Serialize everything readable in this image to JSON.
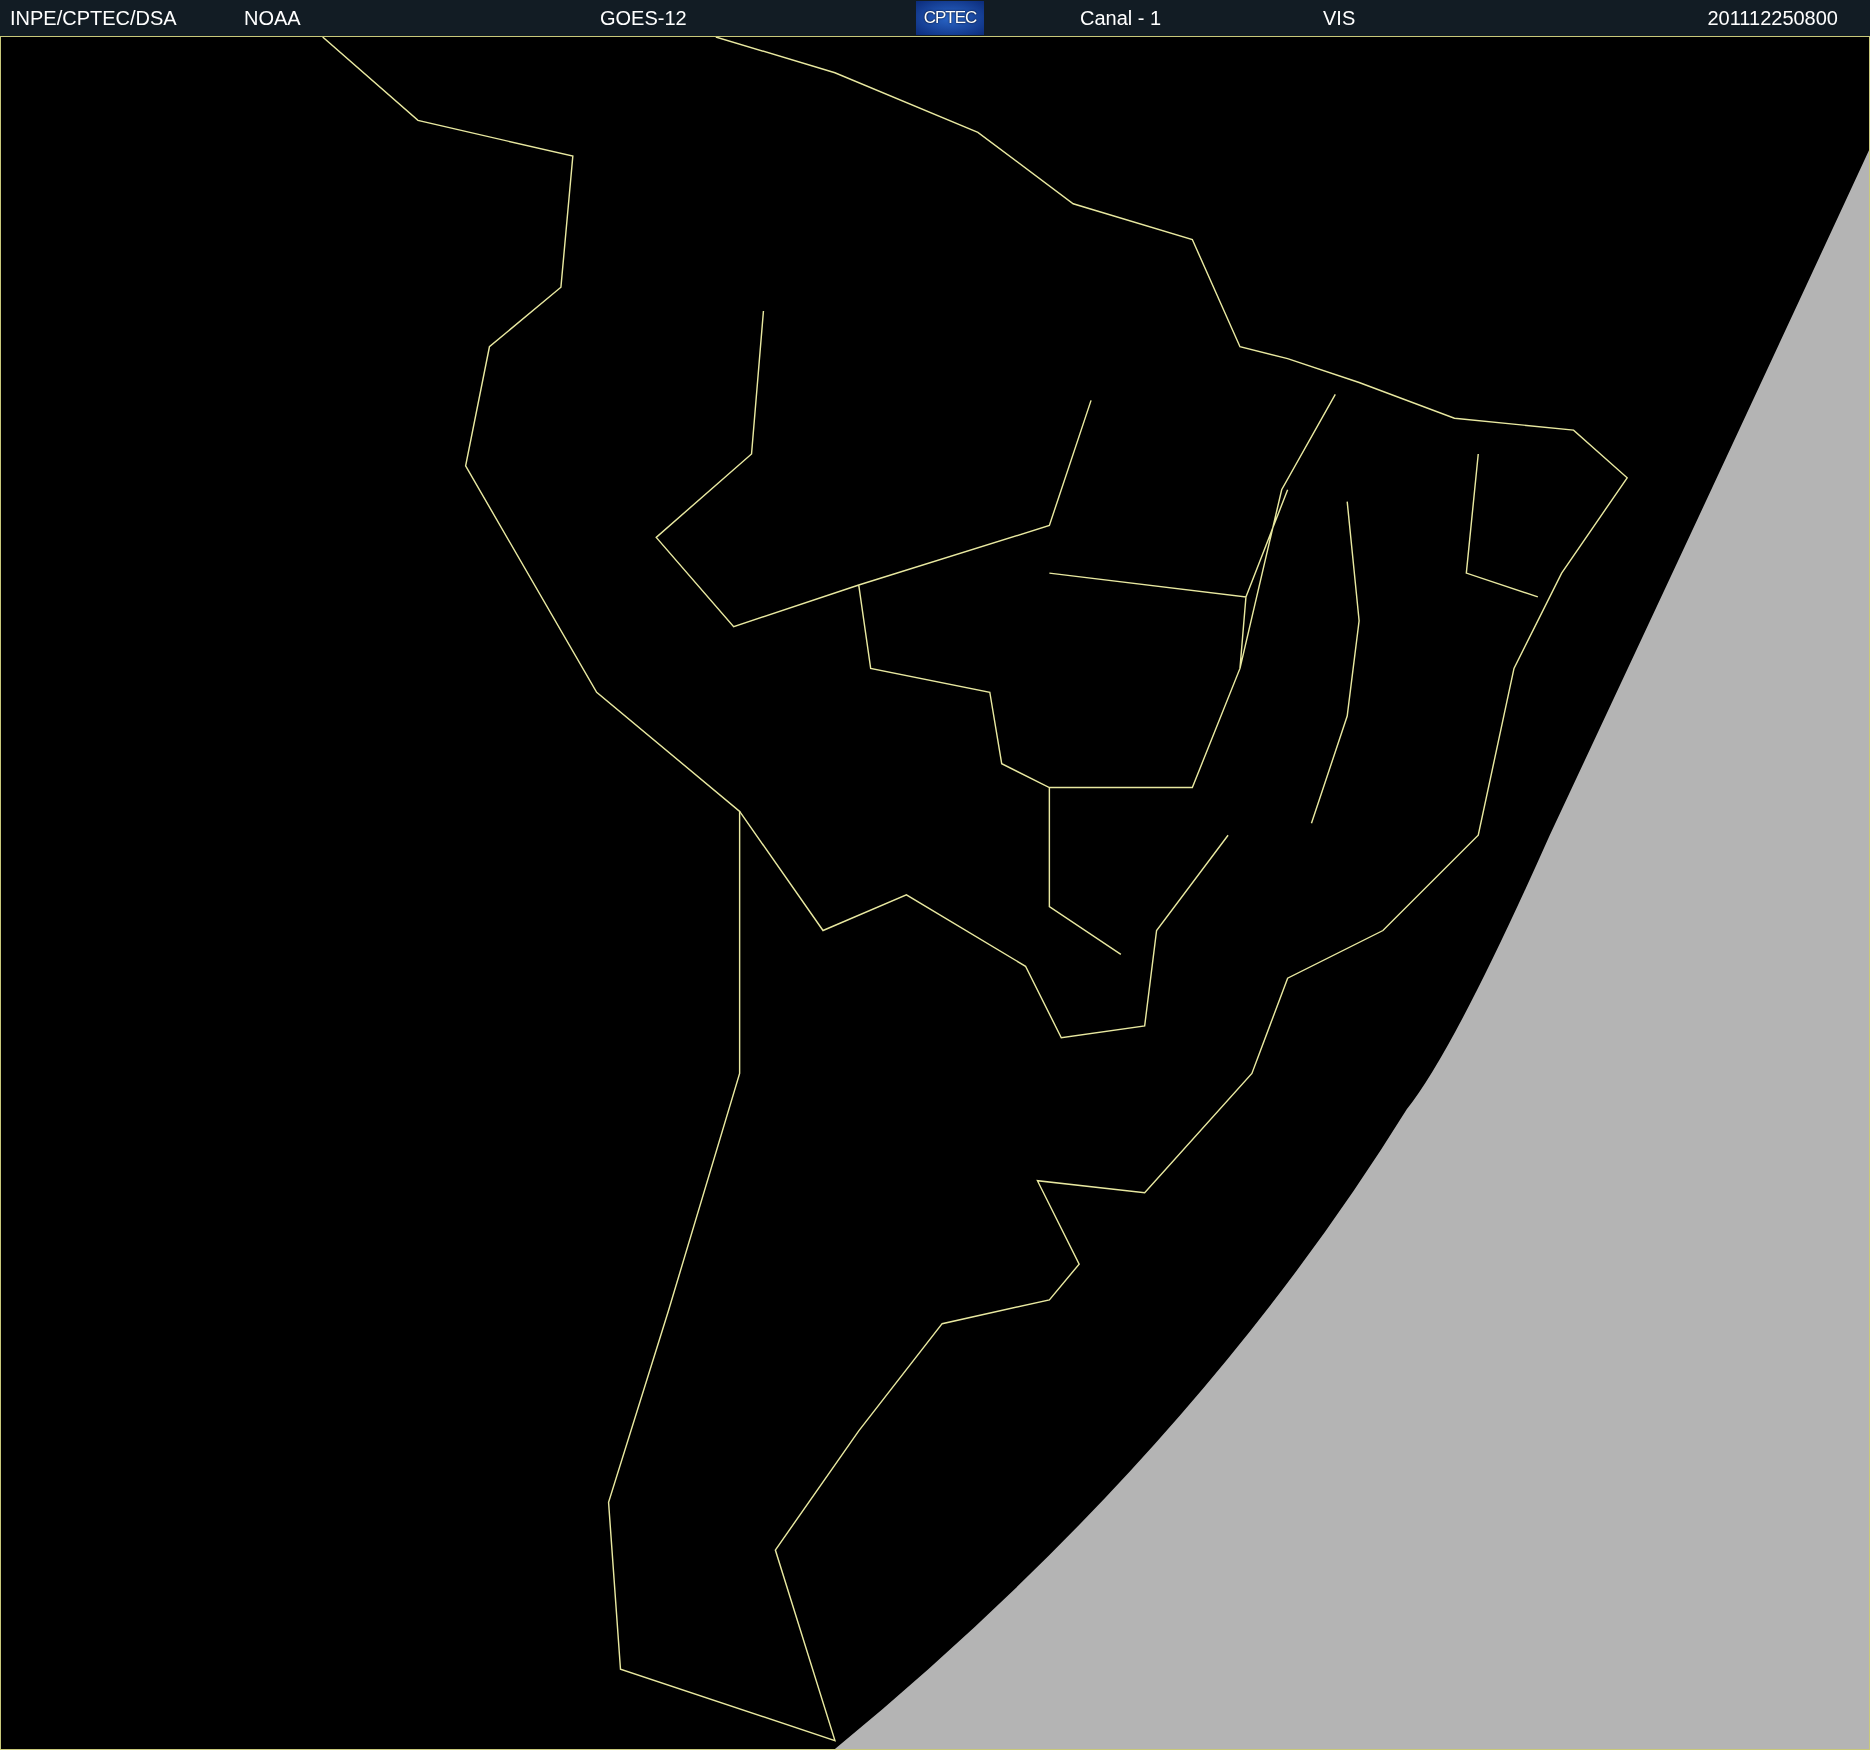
{
  "header": {
    "agency": "INPE/CPTEC/DSA",
    "source": "NOAA",
    "satellite": "GOES-12",
    "logo_text": "CPTEC",
    "channel": "Canal - 1",
    "band": "VIS",
    "timestamp": "201112250800"
  }
}
